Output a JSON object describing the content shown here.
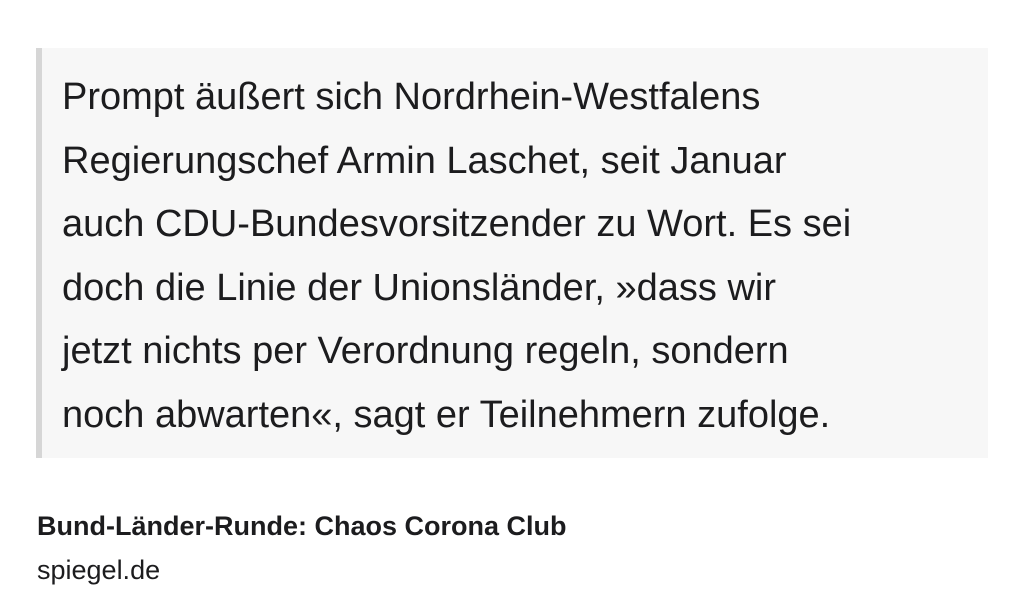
{
  "quote": {
    "lines": [
      "Prompt äußert sich Nordrhein-Westfalens",
      "Regierungschef Armin Laschet, seit Januar",
      "auch CDU-Bundesvorsitzender zu Wort. Es sei",
      "doch die Linie der Unionsländer, »dass wir",
      "jetzt nichts per Verordnung regeln, sondern",
      "noch abwarten«, sagt er Teilnehmern zufolge."
    ]
  },
  "link_preview": {
    "title": "Bund-Länder-Runde: Chaos Corona Club",
    "domain": "spiegel.de"
  }
}
